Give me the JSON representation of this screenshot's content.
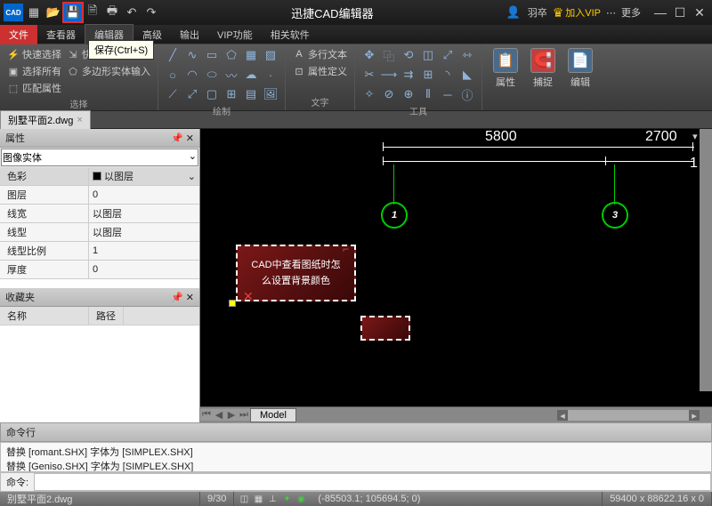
{
  "app_title": "迅捷CAD编辑器",
  "titlebar_user": "羽卒",
  "titlebar_vip": "加入VIP",
  "titlebar_more": "更多",
  "tooltip": "保存(Ctrl+S)",
  "menu": {
    "file": "文件",
    "viewer": "查看器",
    "editor": "编辑器",
    "advanced": "高级",
    "output": "输出",
    "vip": "VIP功能",
    "related": "相关软件"
  },
  "ribbon": {
    "sel": {
      "quick": "快速选择",
      "all": "选择所有",
      "match": "匹配属性"
    },
    "sel2": {
      "quick_import": "快速实体导入",
      "poly_input": "多边形实体输入",
      "label": "选择"
    },
    "draw_label": "绘制",
    "text": {
      "mtext": "多行文本",
      "attrdef": "属性定义",
      "label": "文字"
    },
    "tools_label": "工具",
    "props": "属性",
    "snap": "捕捉",
    "edit": "编辑"
  },
  "filetab": "别墅平面2.dwg",
  "panel": {
    "props_title": "属性",
    "entity": "图像实体",
    "rows": {
      "color_k": "色彩",
      "color_v": "以图层",
      "layer_k": "图层",
      "layer_v": "0",
      "lw_k": "线宽",
      "lw_v": "以图层",
      "lt_k": "线型",
      "lt_v": "以图层",
      "lts_k": "线型比例",
      "lts_v": "1",
      "th_k": "厚度",
      "th_v": "0"
    },
    "fav_title": "收藏夹",
    "fav_name": "名称",
    "fav_path": "路径"
  },
  "canvas": {
    "dim1": "5800",
    "dim2": "2700",
    "side": "1",
    "bubble1": "1",
    "bubble3": "3",
    "red1": "CAD中查看图纸时怎",
    "red2": "么设置背景颜色"
  },
  "model_tab": "Model",
  "cmd": {
    "title": "命令行",
    "log1": "替换 [romant.SHX] 字体为 [SIMPLEX.SHX]",
    "log2": "替换 [Geniso.SHX] 字体为 [SIMPLEX.SHX]",
    "prompt": "命令:"
  },
  "status": {
    "file": "别墅平面2.dwg",
    "page": "9/30",
    "coords": "(-85503.1; 105694.5; 0)",
    "dims": "59400 x 88622.16 x 0"
  }
}
